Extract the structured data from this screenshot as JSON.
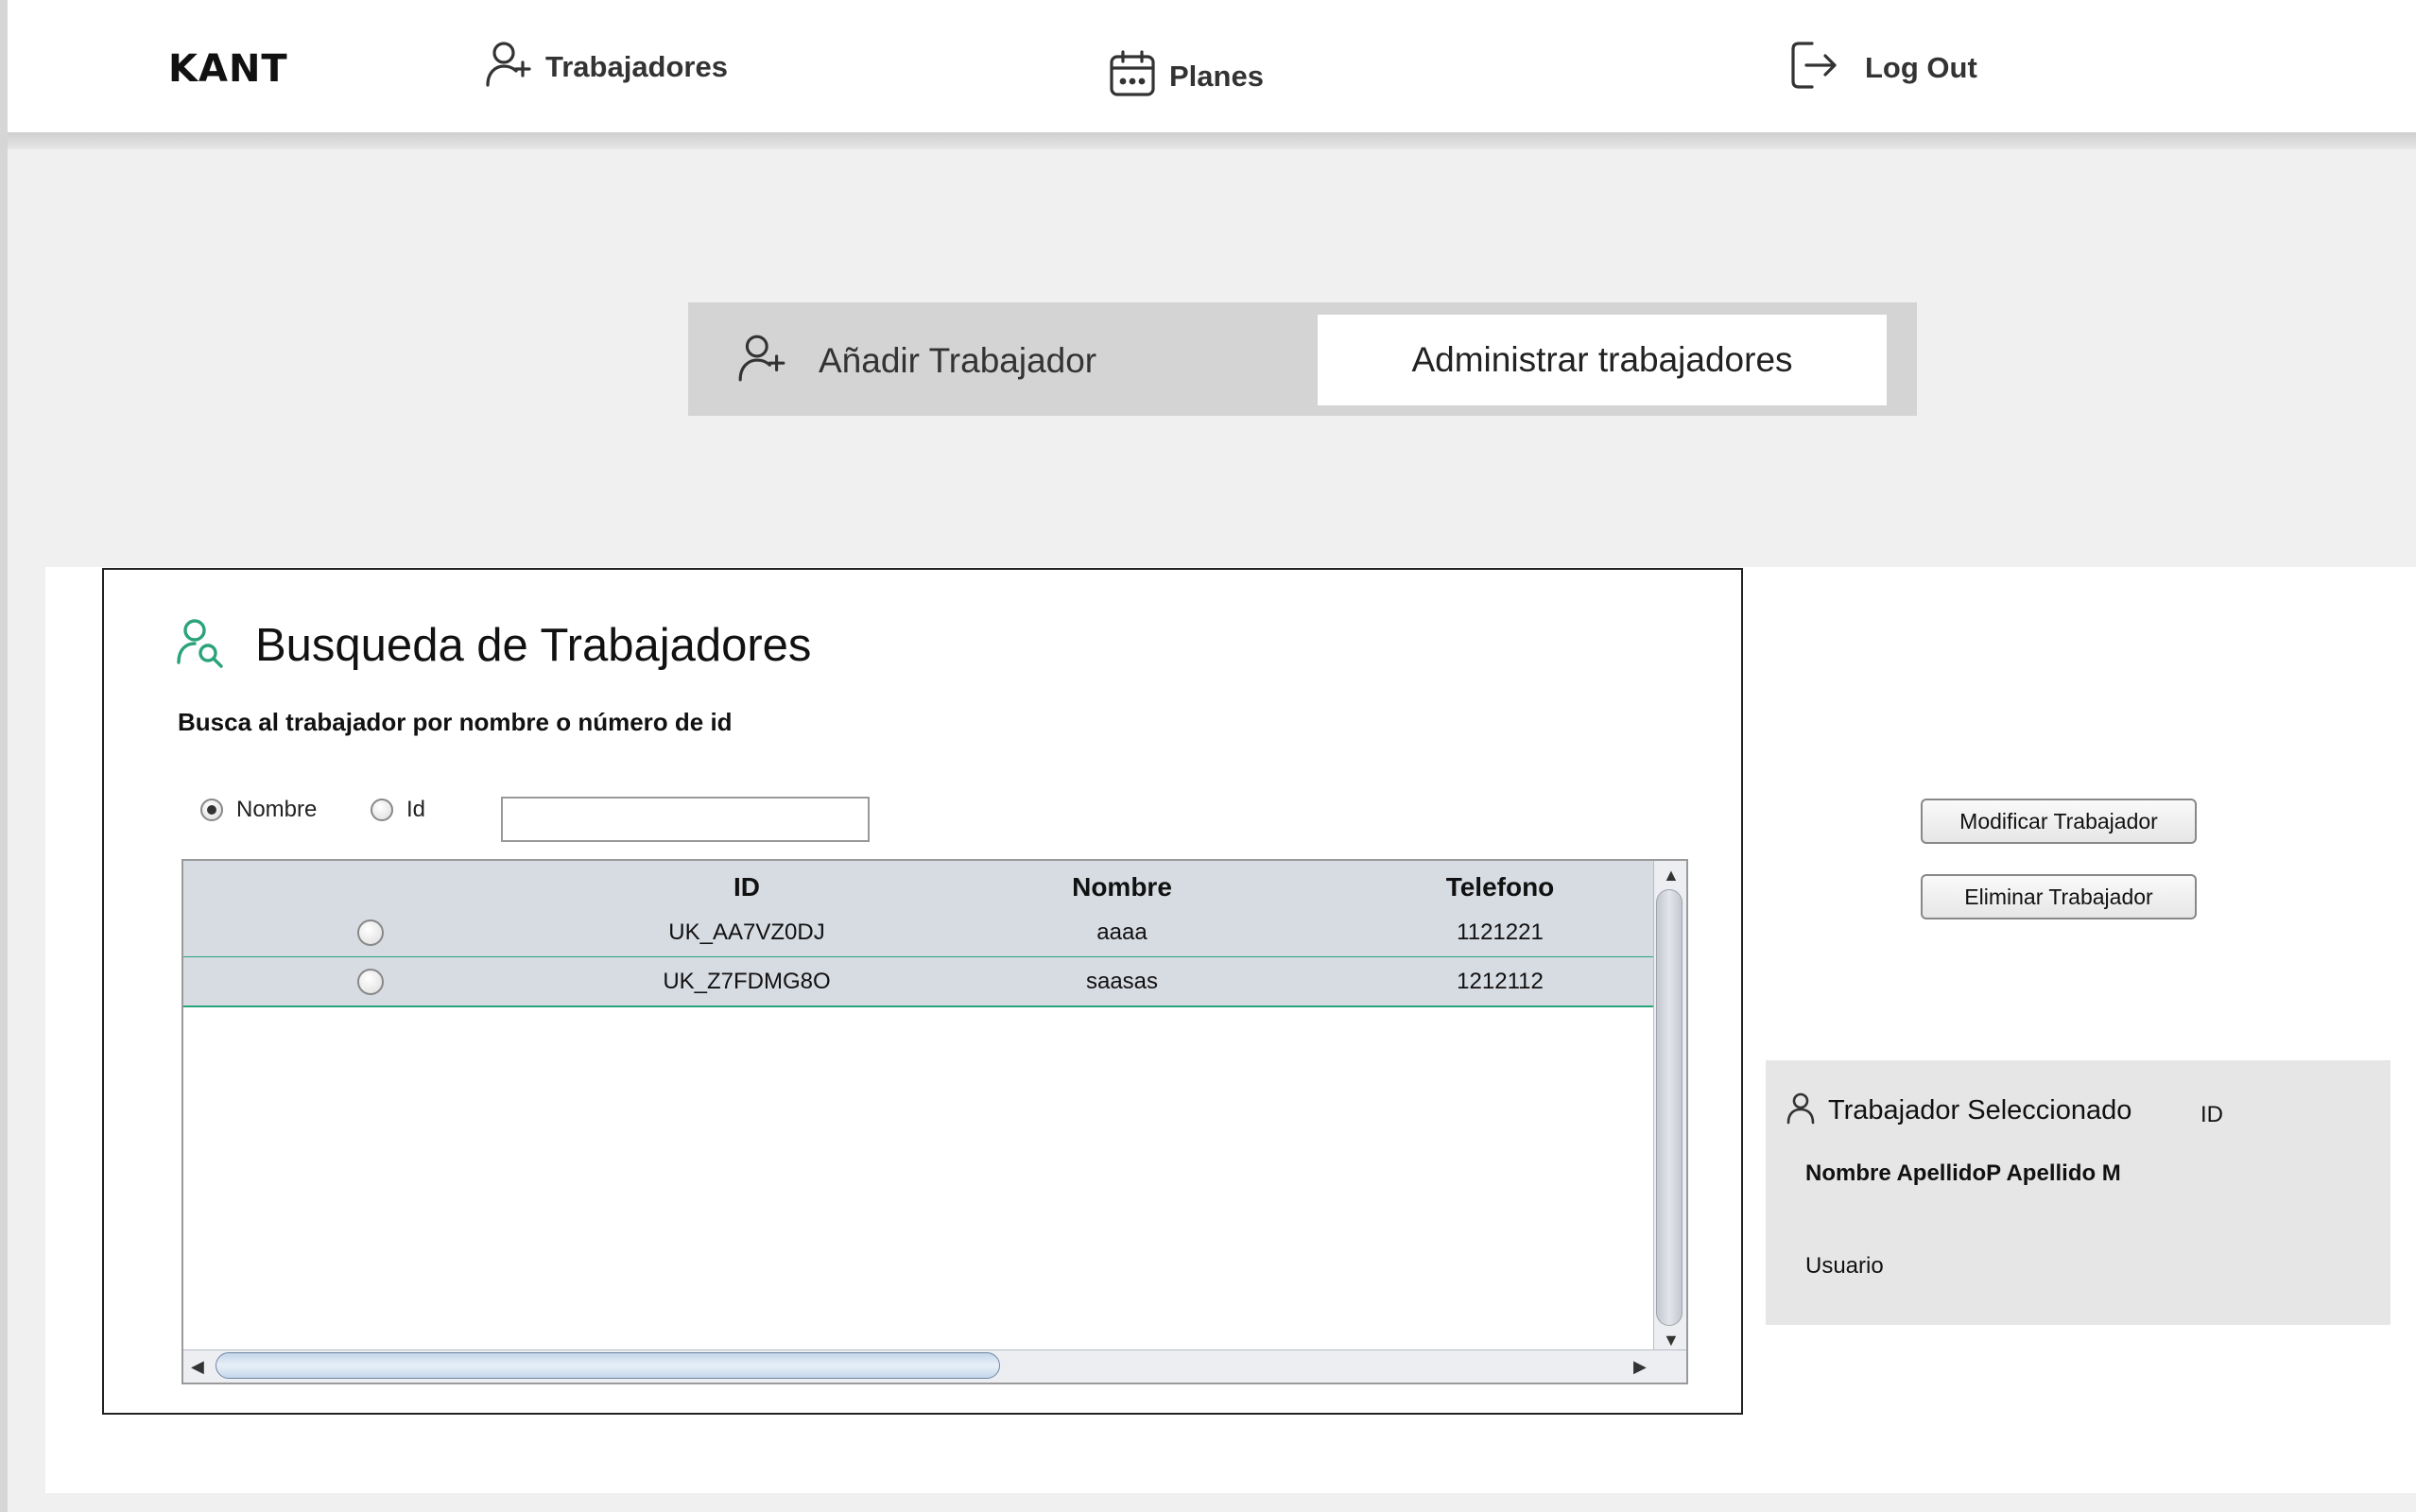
{
  "header": {
    "logo": "KANT",
    "nav": {
      "trabajadores": "Trabajadores",
      "planes": "Planes",
      "logout": "Log Out"
    }
  },
  "tabs": {
    "add": "Añadir Trabajador",
    "admin": "Administrar trabajadores"
  },
  "search": {
    "title": "Busqueda de Trabajadores",
    "subtitle": "Busca al trabajador por nombre o número de id",
    "radio_nombre": "Nombre",
    "radio_id": "Id",
    "selected_filter": "Nombre",
    "input_value": ""
  },
  "table": {
    "columns": [
      "",
      "ID",
      "Nombre",
      "Telefono"
    ],
    "rows": [
      {
        "id": "UK_AA7VZ0DJ",
        "nombre": "aaaa",
        "telefono": "1121221"
      },
      {
        "id": "UK_Z7FDMG8O",
        "nombre": "saasas",
        "telefono": "1212112"
      }
    ]
  },
  "actions": {
    "modify": "Modificar Trabajador",
    "delete": "Eliminar Trabajador"
  },
  "selected": {
    "title": "Trabajador Seleccionado",
    "id_label": "ID",
    "name": "Nombre ApellidoP Apellido M",
    "user": "Usuario"
  },
  "colors": {
    "accent_green": "#2aa37a",
    "table_row_bg": "#d7dbe2"
  }
}
